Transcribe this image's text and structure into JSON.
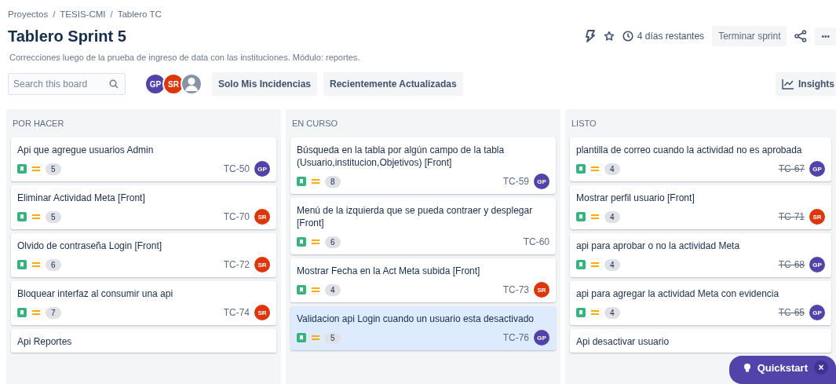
{
  "breadcrumbs": [
    "Proyectos",
    "TESIS-CMI",
    "Tablero TC"
  ],
  "breadcrumb_separators": [
    "/",
    "/"
  ],
  "title": "Tablero Sprint 5",
  "description": "Correcciones luego de la prueba de ingreso de data con las instituciones. Módulo: reportes.",
  "header_actions": {
    "remaining": "4 días restantes",
    "complete_button": "Terminar sprint",
    "more": "•••"
  },
  "search": {
    "placeholder": "Search this board"
  },
  "avatars": [
    {
      "initials": "GP",
      "color": "#5243aa",
      "kind": "initials"
    },
    {
      "initials": "SR",
      "color": "#de350b",
      "kind": "initials"
    },
    {
      "kind": "silhouette",
      "color": "#8993a4"
    }
  ],
  "filters": [
    {
      "label": "Solo Mis Incidencias",
      "selected": false
    },
    {
      "label": "Recientemente Actualizadas",
      "selected": false
    }
  ],
  "insights": "Insights",
  "columns": [
    {
      "title": "POR HACER",
      "done": false,
      "cards": [
        {
          "title": "Api que agregue usuarios Admin",
          "points": "5",
          "key": "TC-50",
          "assignee": {
            "initials": "GP",
            "color": "#5243aa"
          },
          "selected": false
        },
        {
          "title": "Eliminar Actividad Meta [Front]",
          "points": "5",
          "key": "TC-70",
          "assignee": {
            "initials": "SR",
            "color": "#de350b"
          },
          "selected": false
        },
        {
          "title": "Olvido de contraseña Login [Front]",
          "points": "6",
          "key": "TC-72",
          "assignee": {
            "initials": "SR",
            "color": "#de350b"
          },
          "selected": false
        },
        {
          "title": "Bloquear interfaz al consumir una api",
          "points": "7",
          "key": "TC-74",
          "assignee": {
            "initials": "SR",
            "color": "#de350b"
          },
          "selected": false
        },
        {
          "title": "Api Reportes",
          "selected": false
        }
      ]
    },
    {
      "title": "EN CURSO",
      "done": false,
      "cards": [
        {
          "title": "Búsqueda en la tabla por algún campo de la tabla (Usuario,institucion,Objetivos) [Front]",
          "points": "8",
          "key": "TC-59",
          "assignee": {
            "initials": "GP",
            "color": "#5243aa"
          },
          "selected": false
        },
        {
          "title": "Menú de la izquierda que se pueda contraer y desplegar [Front]",
          "points": "6",
          "key": "TC-60",
          "selected": false
        },
        {
          "title": "Mostrar Fecha en la Act Meta subida [Front]",
          "points": "4",
          "key": "TC-73",
          "assignee": {
            "initials": "SR",
            "color": "#de350b"
          },
          "selected": false
        },
        {
          "title": "Validacion api Login cuando un usuario esta desactivado",
          "points": "5",
          "key": "TC-76",
          "assignee": {
            "initials": "GP",
            "color": "#5243aa"
          },
          "selected": true
        }
      ]
    },
    {
      "title": "LISTO",
      "done": true,
      "cards": [
        {
          "title": "plantilla de correo cuando la actividad no es aprobada",
          "points": "4",
          "key": "TC-67",
          "assignee": {
            "initials": "GP",
            "color": "#5243aa"
          },
          "selected": false
        },
        {
          "title": "Mostrar perfil usuario [Front]",
          "points": "4",
          "key": "TC-71",
          "assignee": {
            "initials": "SR",
            "color": "#de350b"
          },
          "selected": false
        },
        {
          "title": "api para aprobar o no la actividad Meta",
          "points": "4",
          "key": "TC-68",
          "assignee": {
            "initials": "GP",
            "color": "#5243aa"
          },
          "selected": false
        },
        {
          "title": "api para agregar la actividad Meta con evidencia",
          "points": "4",
          "key": "TC-65",
          "assignee": {
            "initials": "GP",
            "color": "#5243aa"
          },
          "selected": false
        },
        {
          "title": "Api desactivar usuario",
          "selected": false
        }
      ]
    }
  ],
  "quickstart": {
    "label": "Quickstart",
    "close": "×"
  }
}
